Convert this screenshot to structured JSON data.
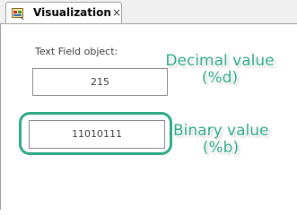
{
  "tab": {
    "title": "Visualization",
    "close_glyph": "×",
    "icon": "visualization-icon"
  },
  "canvas": {
    "heading": "Text Field object:",
    "decimal_field": {
      "value": "215"
    },
    "binary_field": {
      "value": "11010111"
    }
  },
  "annotations": {
    "decimal": {
      "line1": "Decimal value",
      "line2": "(%d)"
    },
    "binary": {
      "line1": "Binary value",
      "line2": "(%b)"
    },
    "color": "#2fa886"
  }
}
